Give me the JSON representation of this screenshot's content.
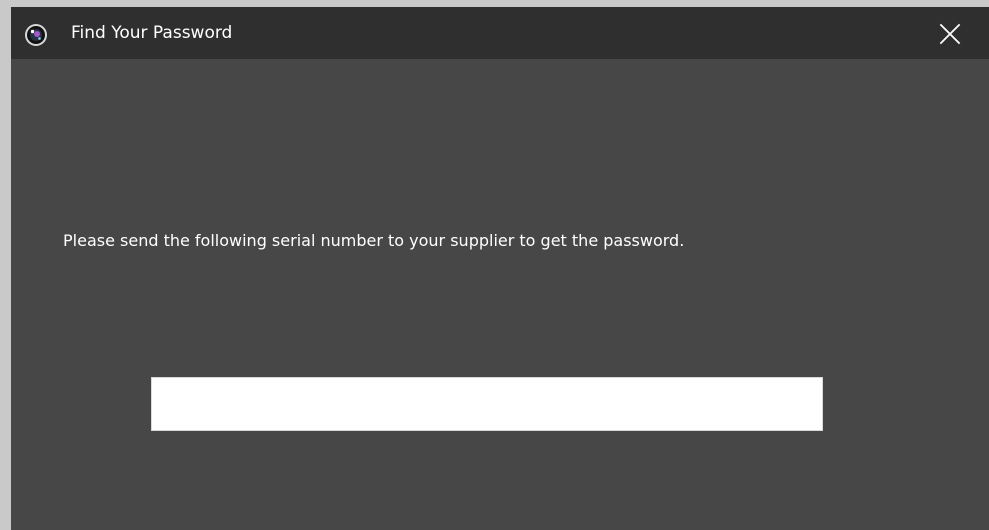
{
  "window": {
    "title": "Find Your Password",
    "app_icon": "camera-lens-icon",
    "close_icon": "close-icon"
  },
  "content": {
    "message": "Please send the following serial number to your supplier to get the password.",
    "serial_number": {
      "value": "",
      "placeholder": ""
    }
  },
  "colors": {
    "window_background": "#474747",
    "titlebar_background": "#2f2f2f",
    "outer_background": "#c9c9c9",
    "text": "#ffffff",
    "field_background": "#ffffff"
  }
}
